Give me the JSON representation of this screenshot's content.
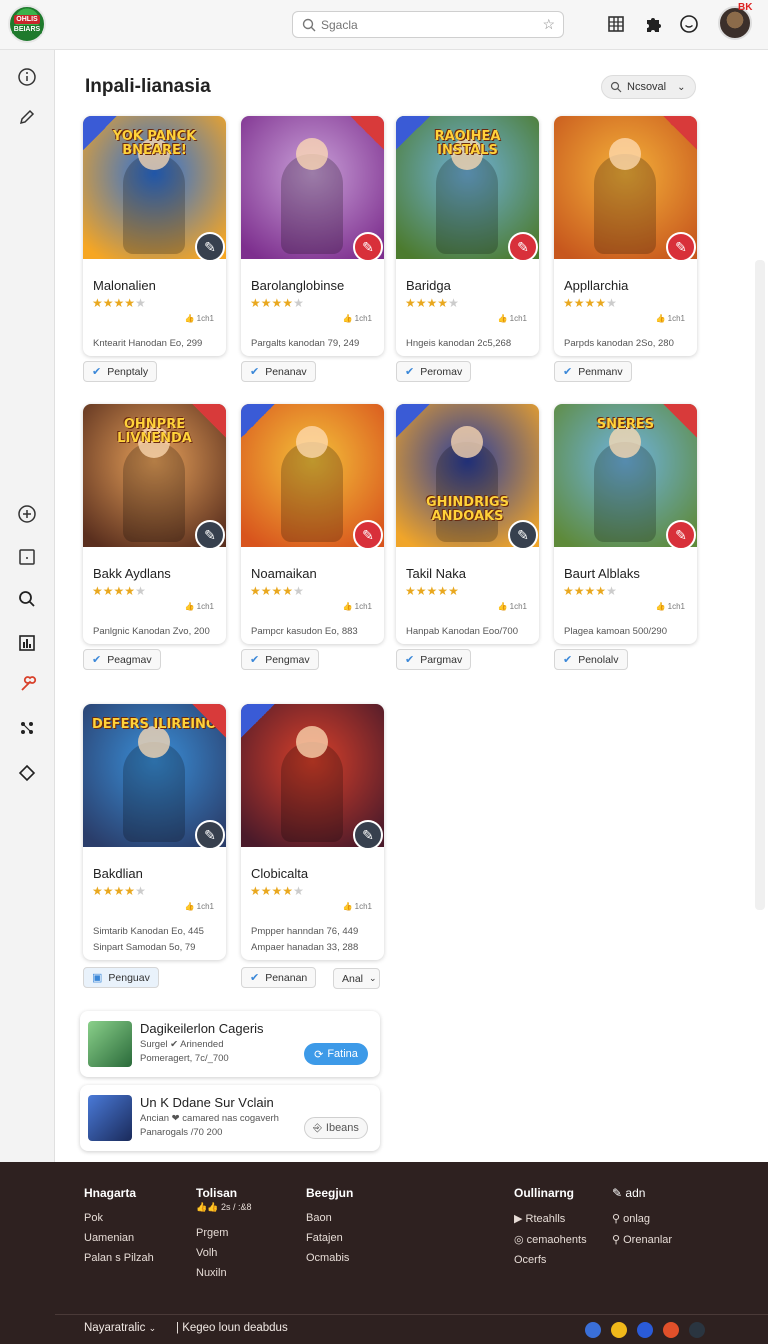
{
  "header": {
    "logo_text": "OHLIS",
    "logo_sub": "BEIARS",
    "search_placeholder": "Sgacla",
    "avatar_badge": "BK",
    "icons": [
      "grid-icon",
      "puzzle-icon",
      "smiley-icon"
    ]
  },
  "sidebar": {
    "items": [
      "info-icon",
      "pen-icon",
      "add-icon",
      "window-icon",
      "search-icon",
      "chart-icon",
      "tool-icon",
      "group-icon",
      "diamond-icon"
    ]
  },
  "main": {
    "title": "Inpali-lianasia",
    "sort_label": "Ncsoval",
    "sort_icon": "chevron-down-icon"
  },
  "cards": [
    {
      "name": "Malonalien",
      "stars": 4,
      "mini": "1ch1",
      "meta": "Kntearit Hanodan  Eo, 299",
      "chip": "Penptaly",
      "art": [
        "#2a6fd8",
        "#f6a623"
      ],
      "ribbon": "#3a5bd6",
      "fab": "#37404e",
      "art_text": "YOK PANCK BNEARE!"
    },
    {
      "name": "Barolanglobinse",
      "stars": 4,
      "mini": "1ch1",
      "meta": "Pargalts kanodan  79, 249",
      "chip": "Penanav",
      "art": [
        "#c9a0d8",
        "#7d2f8e"
      ],
      "ribbon": "#d83a3a",
      "fab": "#d8303a",
      "art_text": ""
    },
    {
      "name": "Baridga",
      "stars": 4,
      "mini": "1ch1",
      "meta": "Hngeis kanodan  2c5,268",
      "chip": "Peromav",
      "art": [
        "#6fb0d8",
        "#4c7b2e"
      ],
      "ribbon": "#3a5bd6",
      "fab": "#d8303a",
      "art_text": "RAOIHEA INSTALS"
    },
    {
      "name": "Appllarchia",
      "stars": 4,
      "mini": "1ch1",
      "meta": "Parpds kanodan  2So, 280",
      "chip": "Penmanv",
      "art": [
        "#f4b13a",
        "#c7571d"
      ],
      "ribbon": "#d83a3a",
      "fab": "#d8303a",
      "art_text": ""
    },
    {
      "name": "Bakk Aydlans",
      "stars": 4,
      "mini": "1ch1",
      "meta": "Panlgnic Kanodan  Zvo, 200",
      "chip": "Peagmav",
      "art": [
        "#e7a15a",
        "#5a2f1e"
      ],
      "ribbon": "#d83a3a",
      "fab": "#37404e",
      "art_text": "OHNPRE LIVNENDA"
    },
    {
      "name": "Noamaikan",
      "stars": 4,
      "mini": "1ch1",
      "meta": "Pampcr kasudon  Eo, 883",
      "chip": "Pengmav",
      "art": [
        "#f4c13a",
        "#d8541d"
      ],
      "ribbon": "#3a5bd6",
      "fab": "#d8303a",
      "art_text": ""
    },
    {
      "name": "Takil Naka",
      "stars": 5,
      "mini": "1ch1",
      "meta": "Hanpab Kanodan  Eoo/700",
      "chip": "Pargmav",
      "art": [
        "#2a3d9a",
        "#f0a52a"
      ],
      "ribbon": "#3a5bd6",
      "fab": "#37404e",
      "art_text": "GHINDRIGS ANDOAKS"
    },
    {
      "name": "Baurt Alblaks",
      "stars": 4,
      "mini": "1ch1",
      "meta": "Plagea kamoan  500/290",
      "chip": "Penolalv",
      "art": [
        "#6fb3e0",
        "#5e8a3a"
      ],
      "ribbon": "#d83a3a",
      "fab": "#d8303a",
      "art_text": "SNERES"
    },
    {
      "name": "Bakdlian",
      "stars": 4,
      "mini": "1ch1",
      "meta": "Simtarib Kanodan  Eo, 445",
      "meta2": "Sinpart Samodan  5o, 79",
      "chip": "Penguav",
      "art": [
        "#3a8fd8",
        "#2a3d6a"
      ],
      "ribbon": "#d83a3a",
      "fab": "#37404e",
      "art_text": "DEFERS ILIREINO"
    },
    {
      "name": "Clobicalta",
      "stars": 4,
      "mini": "1ch1",
      "meta": "Pmpper hanndan  76, 449",
      "meta2": "Ampaer hanadan  33, 288",
      "chip": "Penanan",
      "art": [
        "#d8402a",
        "#4a1a2a"
      ],
      "ribbon": "#3a5bd6",
      "fab": "#37404e",
      "art_text": ""
    }
  ],
  "extra_chip": "Anal",
  "people": [
    {
      "title": "Dagikeilerlon Cageris",
      "line1": "Surgel  ✔  Arinended",
      "line2": "Pomeragert, 7c/_700",
      "button": "Fatina",
      "button_icon": "refresh-icon"
    },
    {
      "title": "Un K Ddane Sur Vclain",
      "line1": "Ancian ❤ camared nas cogaverh",
      "line2": "Panarogals /70 200",
      "button": "Ibeans",
      "button_icon": "login-icon"
    }
  ],
  "footer": {
    "col1": {
      "heading": "Hnagarta",
      "items": [
        "Pok",
        "Uamenian",
        "Palan s Pilzah"
      ]
    },
    "col2": {
      "heading": "Tolisan",
      "sub": "2s / :&8",
      "items": [
        "Prgem",
        "Volh",
        "Nuxiln"
      ]
    },
    "col3": {
      "heading": "Beegjun",
      "items": [
        "Baon",
        "Fatajen",
        "Ocmabis"
      ]
    },
    "col4": {
      "heading": "Oullinarng",
      "items": [
        "Rteahlls",
        "cemaohents",
        "Ocerfs"
      ]
    },
    "col5": {
      "heading": "adn",
      "items": [
        "onlag",
        "Orenanlar"
      ]
    },
    "bottom_left": "Nayaratralic",
    "bottom_mid": "Kegeo loun deabdus",
    "social_colors": [
      "#3a6fd8",
      "#f0b81a",
      "#2a5bd8",
      "#e0502a",
      "#2a3540"
    ]
  }
}
